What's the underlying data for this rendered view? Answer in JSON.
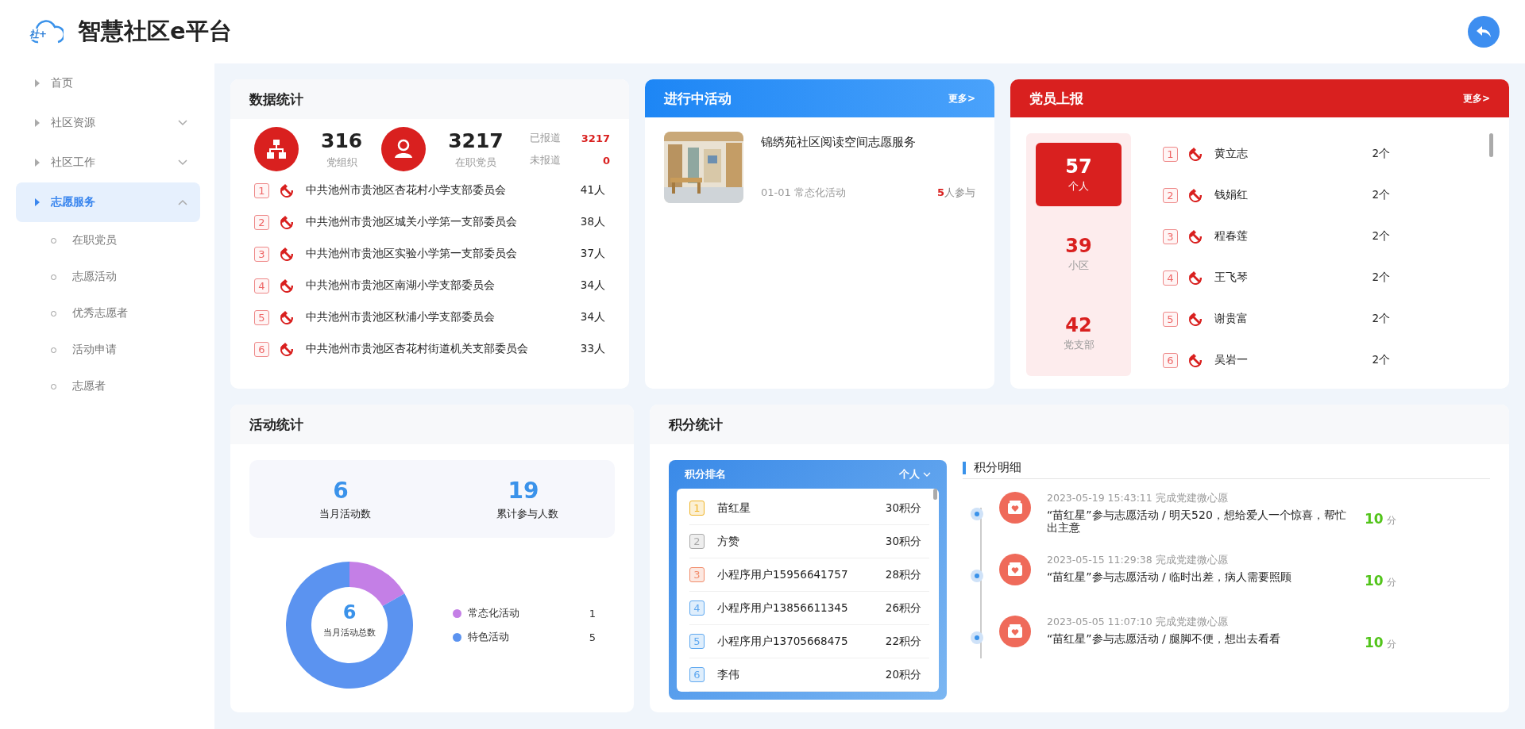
{
  "header": {
    "title": "智慧社区e平台",
    "logo_text": "社+"
  },
  "sidebar": {
    "items": [
      {
        "label": "首页",
        "kind": "link",
        "selected": false
      },
      {
        "label": "社区资源",
        "kind": "group",
        "expanded": false,
        "selected": false
      },
      {
        "label": "社区工作",
        "kind": "group",
        "expanded": false,
        "selected": false
      },
      {
        "label": "志愿服务",
        "kind": "group",
        "expanded": true,
        "selected": true,
        "children": [
          {
            "label": "在职党员",
            "selected": false
          },
          {
            "label": "志愿活动",
            "selected": false
          },
          {
            "label": "优秀志愿者",
            "selected": false
          },
          {
            "label": "活动申请",
            "selected": false
          },
          {
            "label": "志愿者",
            "selected": false
          }
        ]
      }
    ]
  },
  "data_stats": {
    "title": "数据统计",
    "summary": [
      {
        "kind": "org",
        "value": "316",
        "label": "党组织"
      },
      {
        "kind": "member",
        "value": "3217",
        "label": "在职党员"
      }
    ],
    "report": [
      {
        "label": "已报道",
        "value": "3217"
      },
      {
        "label": "未报道",
        "value": "0"
      }
    ],
    "rows": [
      {
        "rank": "1",
        "name": "中共池州市贵池区杏花村小学支部委员会",
        "count": "41人"
      },
      {
        "rank": "2",
        "name": "中共池州市贵池区城关小学第一支部委员会",
        "count": "38人"
      },
      {
        "rank": "3",
        "name": "中共池州市贵池区实验小学第一支部委员会",
        "count": "37人"
      },
      {
        "rank": "4",
        "name": "中共池州市贵池区南湖小学支部委员会",
        "count": "34人"
      },
      {
        "rank": "5",
        "name": "中共池州市贵池区秋浦小学支部委员会",
        "count": "34人"
      },
      {
        "rank": "6",
        "name": "中共池州市贵池区杏花村街道机关支部委员会",
        "count": "33人"
      }
    ]
  },
  "ongoing": {
    "title": "进行中活动",
    "more": "更多>",
    "items": [
      {
        "title": "锦绣苑社区阅读空间志愿服务",
        "meta": "01-01 常态化活动",
        "count": "5",
        "count_suffix": "人参与"
      }
    ]
  },
  "reports": {
    "title": "党员上报",
    "more": "更多>",
    "stats": [
      {
        "value": "57",
        "label": "个人",
        "selected": true
      },
      {
        "value": "39",
        "label": "小区",
        "selected": false
      },
      {
        "value": "42",
        "label": "党支部",
        "selected": false
      }
    ],
    "rows": [
      {
        "rank": "1",
        "name": "黄立志",
        "count": "2个"
      },
      {
        "rank": "2",
        "name": "钱娟红",
        "count": "2个"
      },
      {
        "rank": "3",
        "name": "程春莲",
        "count": "2个"
      },
      {
        "rank": "4",
        "name": "王飞琴",
        "count": "2个"
      },
      {
        "rank": "5",
        "name": "谢贵富",
        "count": "2个"
      },
      {
        "rank": "6",
        "name": "吴岩一",
        "count": "2个"
      }
    ]
  },
  "activity_stats": {
    "title": "活动统计",
    "totals": [
      {
        "value": "6",
        "label": "当月活动数"
      },
      {
        "value": "19",
        "label": "累计参与人数"
      }
    ],
    "chart_data": {
      "type": "donut",
      "values": [
        16.7,
        83.3
      ]
    },
    "center_value": "6",
    "center_label": "当月活动总数",
    "legend": [
      {
        "label": "常态化活动",
        "value": "1",
        "color": "#c47fe6"
      },
      {
        "label": "特色活动",
        "value": "5",
        "color": "#5b93f0"
      }
    ]
  },
  "points": {
    "title": "积分统计",
    "ranking": {
      "title": "积分排名",
      "filter": "个人",
      "rows": [
        {
          "rank": "1",
          "name": "苗红星",
          "points": "30积分",
          "color": "#f0b429"
        },
        {
          "rank": "2",
          "name": "方赞",
          "points": "30积分",
          "color": "#a8a8a8"
        },
        {
          "rank": "3",
          "name": "小程序用户15956641757",
          "points": "28积分",
          "color": "#f28c6b"
        },
        {
          "rank": "4",
          "name": "小程序用户13856611345",
          "points": "26积分",
          "color": "#5fa8f0"
        },
        {
          "rank": "5",
          "name": "小程序用户13705668475",
          "points": "22积分",
          "color": "#5fa8f0"
        },
        {
          "rank": "6",
          "name": "李伟",
          "points": "20积分",
          "color": "#5fa8f0"
        }
      ]
    },
    "detail": {
      "title": "积分明细",
      "entries": [
        {
          "time": "2023-05-19 15:43:11 完成党建微心愿",
          "text": "“苗红星”参与志愿活动 / 明天520，想给爱人一个惊喜，帮忙出主意",
          "score": "10",
          "unit": "分"
        },
        {
          "time": "2023-05-15 11:29:38 完成党建微心愿",
          "text": "“苗红星”参与志愿活动 / 临时出差，病人需要照顾",
          "score": "10",
          "unit": "分"
        },
        {
          "time": "2023-05-05 11:07:10 完成党建微心愿",
          "text": "“苗红星”参与志愿活动 / 腿脚不便，想出去看看",
          "score": "10",
          "unit": "分"
        }
      ]
    }
  }
}
